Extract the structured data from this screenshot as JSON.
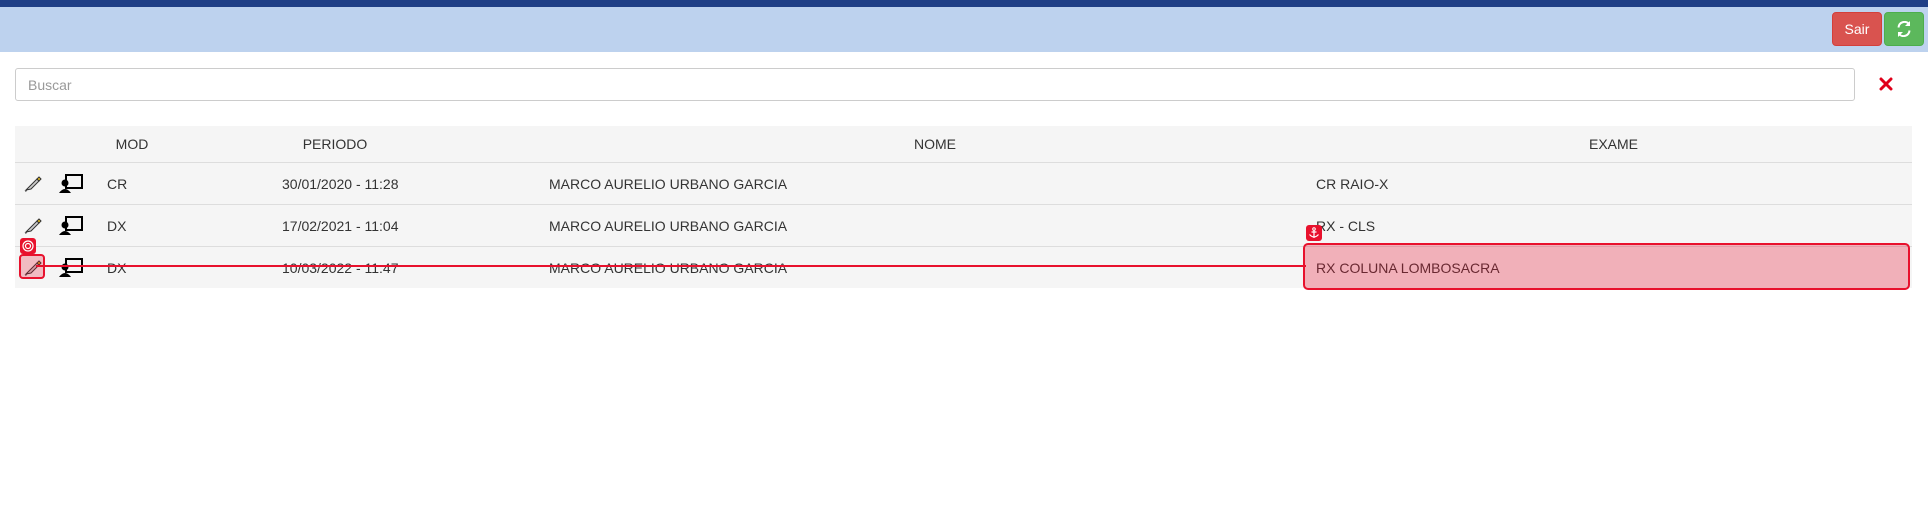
{
  "header": {
    "sair_label": "Sair",
    "refresh_icon": "refresh-icon",
    "bar_color": "#bdd2ee",
    "stripe_color": "#1f3f86",
    "sair_color": "#d9534f",
    "refresh_color": "#5cb85c"
  },
  "search": {
    "placeholder": "Buscar",
    "value": "",
    "clear_icon": "clear-x-icon"
  },
  "table": {
    "columns": [
      "MOD",
      "PERIODO",
      "NOME",
      "EXAME"
    ],
    "rows": [
      {
        "mod": "CR",
        "periodo": "30/01/2020 - 11:28",
        "nome": "MARCO AURELIO URBANO GARCIA",
        "exame": "CR RAIO-X",
        "icons": [
          "pen-icon",
          "viewer-icon"
        ]
      },
      {
        "mod": "DX",
        "periodo": "17/02/2021 - 11:04",
        "nome": "MARCO AURELIO URBANO GARCIA",
        "exame": "RX - CLS",
        "icons": [
          "pen-icon",
          "viewer-icon"
        ]
      },
      {
        "mod": "DX",
        "periodo": "10/03/2022 - 11:47",
        "nome": "MARCO AURELIO URBANO GARCIA",
        "exame": "RX COLUNA LOMBOSACRA",
        "icons": [
          "pen-icon",
          "viewer-icon"
        ]
      }
    ]
  },
  "annotation": {
    "color": "#e8112d",
    "source_icon": "target-icon",
    "target_icon": "anchor-icon"
  }
}
